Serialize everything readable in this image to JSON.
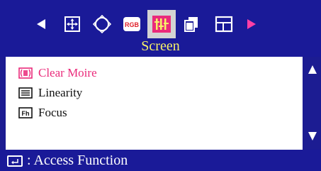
{
  "header": {
    "title": "Screen"
  },
  "toolbar": {
    "icons": [
      {
        "name": "left-arrow-icon"
      },
      {
        "name": "position-icon"
      },
      {
        "name": "geometry-icon"
      },
      {
        "name": "rgb-icon",
        "label": "RGB"
      },
      {
        "name": "screen-icon",
        "selected": true
      },
      {
        "name": "multi-window-icon"
      },
      {
        "name": "window-icon"
      },
      {
        "name": "right-arrow-icon"
      }
    ]
  },
  "menu": {
    "items": [
      {
        "label": "Clear Moire",
        "icon": "clear-moire-icon",
        "active": true
      },
      {
        "label": "Linearity",
        "icon": "linearity-icon",
        "active": false
      },
      {
        "label": "Focus",
        "icon": "focus-icon",
        "active": false
      }
    ]
  },
  "footer": {
    "hint": ": Access Function",
    "icon": "enter-icon"
  },
  "colors": {
    "background": "#1c1c92",
    "title": "#f7f268",
    "active_item": "#ea2a7a",
    "selected_icon_bg": "#d3d3d3",
    "right_arrow": "#ff3fa6"
  }
}
